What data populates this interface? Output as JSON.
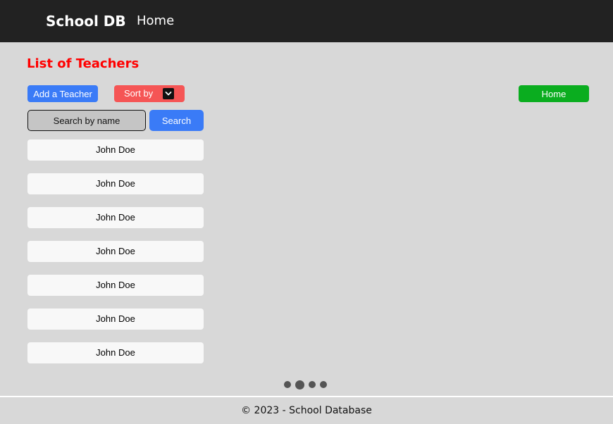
{
  "navbar": {
    "brand": "School DB",
    "home_link": "Home"
  },
  "page": {
    "title": "List of Teachers"
  },
  "toolbar": {
    "add_label": "Add a Teacher",
    "sort_label": "Sort by",
    "sort_icon": "chevron-down-icon",
    "home_label": "Home"
  },
  "search": {
    "placeholder": "Search by name",
    "value": "",
    "button_label": "Search"
  },
  "teachers": [
    {
      "name": "John Doe"
    },
    {
      "name": "John Doe"
    },
    {
      "name": "John Doe"
    },
    {
      "name": "John Doe"
    },
    {
      "name": "John Doe"
    },
    {
      "name": "John Doe"
    },
    {
      "name": "John Doe"
    }
  ],
  "pagination": {
    "pages": 4,
    "current": 2
  },
  "footer": {
    "text": "© 2023 - School Database"
  },
  "colors": {
    "navbar": "#222222",
    "title": "#ff0000",
    "add_button": "#3a7bf7",
    "sort_button": "#f55555",
    "home_button": "#0aad1f",
    "search_button": "#3a7bf7"
  }
}
